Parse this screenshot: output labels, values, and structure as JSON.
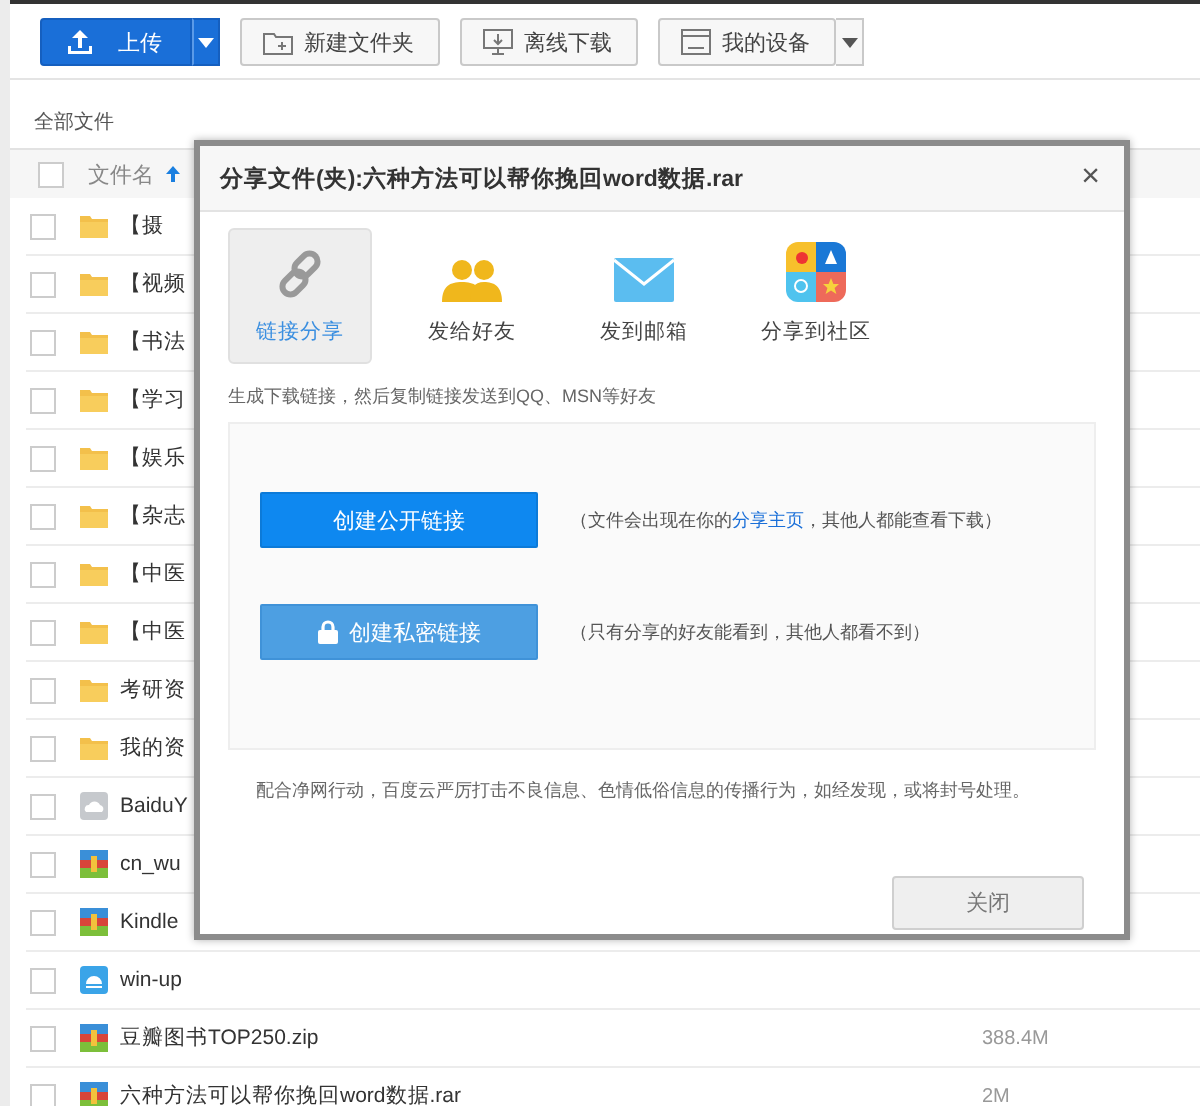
{
  "toolbar": {
    "upload": "上传",
    "buttons": [
      {
        "label": "新建文件夹",
        "kind": "folder"
      },
      {
        "label": "离线下载",
        "kind": "download"
      },
      {
        "label": "我的设备",
        "kind": "device"
      }
    ]
  },
  "breadcrumb": "全部文件",
  "table": {
    "header": {
      "label": "文件名",
      "checked": false
    },
    "rows": [
      {
        "name": "【摄",
        "kind": "folder",
        "checked": false
      },
      {
        "name": "【视频",
        "kind": "folder",
        "checked": false
      },
      {
        "name": "【书法",
        "kind": "folder",
        "checked": false
      },
      {
        "name": "【学习",
        "kind": "folder",
        "checked": false
      },
      {
        "name": "【娱乐",
        "kind": "folder",
        "checked": false
      },
      {
        "name": "【杂志",
        "kind": "folder",
        "checked": false
      },
      {
        "name": "【中医",
        "kind": "folder",
        "checked": false
      },
      {
        "name": "【中医",
        "kind": "folder",
        "checked": false
      },
      {
        "name": "考研资",
        "kind": "folder",
        "checked": false
      },
      {
        "name": "我的资",
        "kind": "folder",
        "checked": false
      },
      {
        "name": "BaiduY",
        "kind": "cloud",
        "checked": false
      },
      {
        "name": "cn_wu",
        "kind": "archive",
        "checked": false
      },
      {
        "name": "Kindle",
        "kind": "archive",
        "checked": false
      },
      {
        "name": "win-up",
        "kind": "installer",
        "checked": false
      },
      {
        "name": "豆瓣图书TOP250.zip",
        "kind": "archive",
        "checked": false,
        "size": "388.4M"
      },
      {
        "name": "六种方法可以帮你挽回word数据.rar",
        "kind": "archive",
        "checked": false,
        "size": "2M"
      }
    ]
  },
  "dialog": {
    "title": "分享文件(夹):六种方法可以帮你挽回word数据.rar",
    "close": "×",
    "options": [
      {
        "label": "链接分享",
        "kind": "link",
        "selected": true
      },
      {
        "label": "发给好友",
        "kind": "friends",
        "selected": false
      },
      {
        "label": "发到邮箱",
        "kind": "mail",
        "selected": false
      },
      {
        "label": "分享到社区",
        "kind": "community",
        "selected": false
      }
    ],
    "description": "生成下载链接，然后复制链接发送到QQ、MSN等好友",
    "links": [
      {
        "button": "创建公开链接",
        "kind": "public",
        "note": "（文件会出现在你的",
        "note_link": "分享主页",
        "note_after": "，其他人都能查看下载）"
      },
      {
        "button": "创建私密链接",
        "kind": "private",
        "note": "（只有分享的好友能看到，其他人都看不到）"
      }
    ],
    "notice": "配合净网行动，百度云严厉打击不良信息、色情低俗信息的传播行为，如经发现，或将封号处理。",
    "close_button": "关闭"
  }
}
